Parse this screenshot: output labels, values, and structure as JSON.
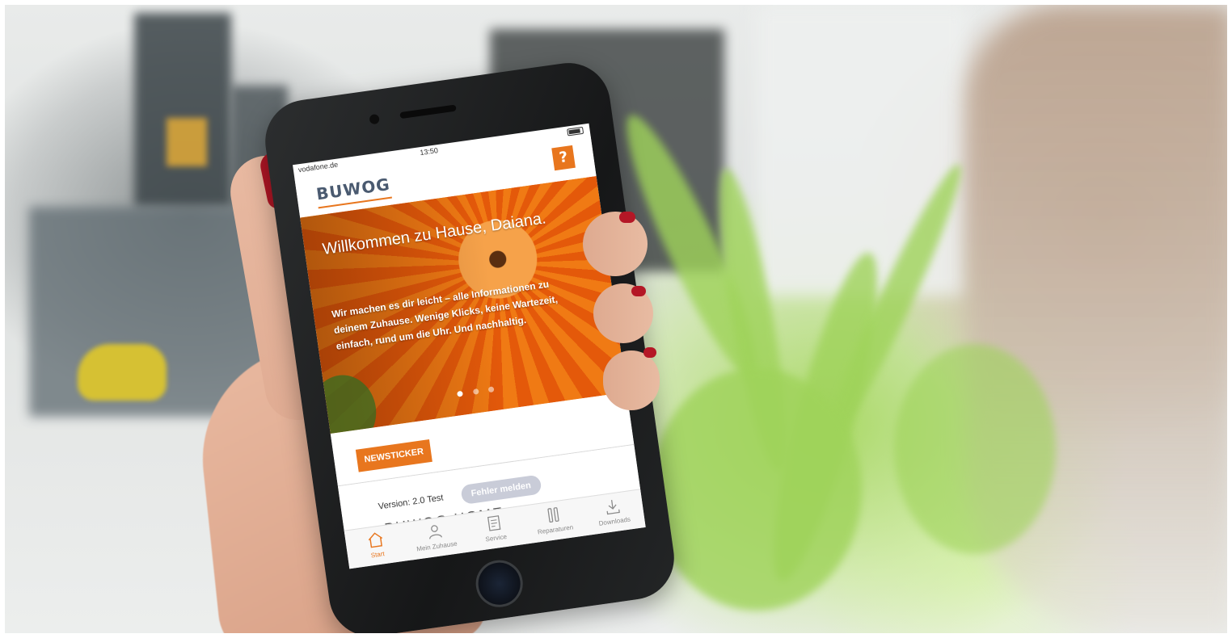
{
  "status_bar": {
    "carrier": "vodafone.de",
    "time": "13:50"
  },
  "app": {
    "logo_text": "BUWOG",
    "help_label": "?"
  },
  "hero": {
    "title": "Willkommen zu Hause, Daiana.",
    "text": "Wir machen es dir leicht – alle Informationen zu deinem Zuhause. Wenige Klicks, keine Wartezeit, einfach, rund um die Uhr. Und nachhaltig.",
    "slide_count": 3,
    "active_slide": 1
  },
  "newsticker": {
    "label": "NEWSTICKER"
  },
  "version": {
    "text": "Version: 2.0 Test",
    "report_button": "Fehler melden"
  },
  "section": {
    "heading": "BUWOG HOME"
  },
  "tab_bar": {
    "items": [
      {
        "label": "Start",
        "icon": "home-icon",
        "active": true
      },
      {
        "label": "Mein Zuhause",
        "icon": "person-icon",
        "active": false
      },
      {
        "label": "Service",
        "icon": "document-icon",
        "active": false
      },
      {
        "label": "Reparaturen",
        "icon": "tools-icon",
        "active": false
      },
      {
        "label": "Downloads",
        "icon": "download-icon",
        "active": false
      }
    ]
  },
  "colors": {
    "accent": "#e8761e",
    "logo": "#4a5a70",
    "report_button": "#c9ccd8",
    "nail_polish": "#b01625"
  }
}
